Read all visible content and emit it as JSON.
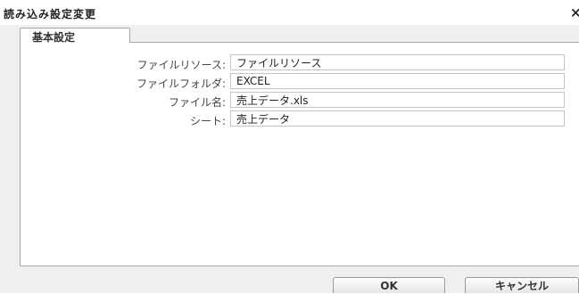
{
  "dialog": {
    "title": "読み込み設定変更",
    "close_glyph": "×"
  },
  "tabs": [
    {
      "label": "基本設定",
      "active": true
    }
  ],
  "form": {
    "fields": [
      {
        "label": "ファイルリソース:",
        "value": "ファイルリソース"
      },
      {
        "label": "ファイルフォルダ:",
        "value": "EXCEL"
      },
      {
        "label": "ファイル名:",
        "value": "売上データ.xls"
      },
      {
        "label": "シート:",
        "value": "売上データ"
      }
    ]
  },
  "buttons": {
    "ok_label": "OK",
    "cancel_label": "キャンセル"
  }
}
